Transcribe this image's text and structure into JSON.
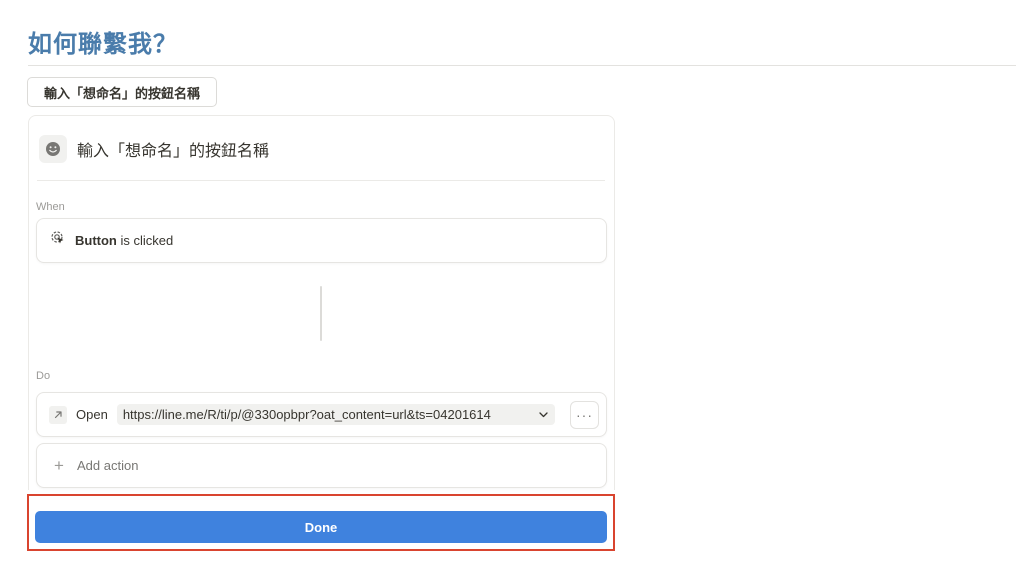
{
  "page": {
    "title": "如何聯繫我？",
    "button_block_label": "輸入「想命名」的按鈕名稱"
  },
  "automation": {
    "icon": "smiley-face-icon",
    "name": "輸入「想命名」的按鈕名稱",
    "when_label": "When",
    "trigger": {
      "icon": "cursor-click-icon",
      "subject": "Button",
      "predicate": "is clicked"
    },
    "do_label": "Do",
    "action": {
      "icon": "arrow-up-right-icon",
      "verb": "Open",
      "url": "https://line.me/R/ti/p/@330opbpr?oat_content=url&ts=04201614",
      "more_icon": "more-dots-icon",
      "more_glyph": "···"
    },
    "add_action": {
      "icon": "plus-icon",
      "glyph": "+",
      "label": "Add action"
    },
    "done_label": "Done"
  },
  "colors": {
    "title": "#4a7cab",
    "primary": "#3f82de",
    "highlight": "#d9442f"
  }
}
